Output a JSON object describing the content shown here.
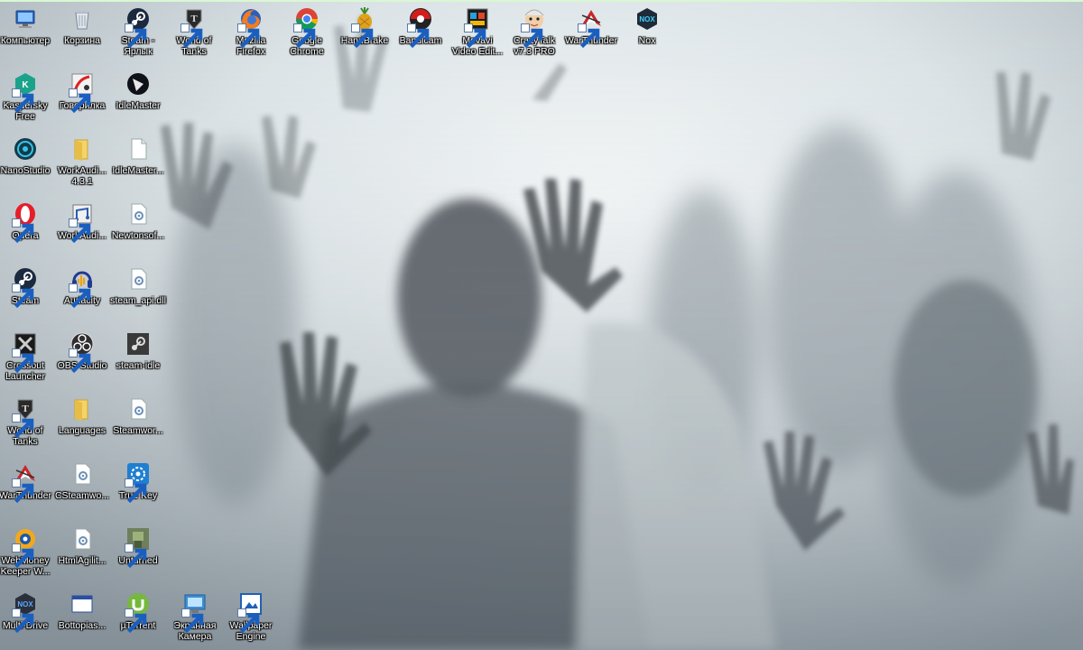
{
  "desktop": {
    "icons": [
      {
        "label": "Компьютер",
        "icon": "computer-icon"
      },
      {
        "label": "Корзина",
        "icon": "recycle-bin-icon"
      },
      {
        "label": "Steam -\nЯрлык",
        "icon": "steam-icon"
      },
      {
        "label": "World of\nTanks",
        "icon": "world-of-tanks-icon"
      },
      {
        "label": "Mozilla\nFirefox",
        "icon": "firefox-icon"
      },
      {
        "label": "Google\nChrome",
        "icon": "chrome-icon"
      },
      {
        "label": "HandBrake",
        "icon": "handbrake-icon"
      },
      {
        "label": "Bandicam",
        "icon": "bandicam-icon"
      },
      {
        "label": "Movavi\nVideo Edit...",
        "icon": "movavi-icon"
      },
      {
        "label": "CrazyTalk\nv7.3 PRO",
        "icon": "crazytalk-icon"
      },
      {
        "label": "WarThunder",
        "icon": "warthunder-icon"
      },
      {
        "label": "Nox",
        "icon": "nox-icon"
      },
      {
        "label": "Kaspersky\nFree",
        "icon": "kaspersky-icon"
      },
      {
        "label": "Говорилка",
        "icon": "govorilka-icon"
      },
      {
        "label": "IdleMaster",
        "icon": "idlemaster-icon"
      },
      {
        "label": "NanoStudio",
        "icon": "nanostudio-icon"
      },
      {
        "label": "WorkAudi...\n4.3.1",
        "icon": "folder-icon"
      },
      {
        "label": "IdleMaster...",
        "icon": "file-icon"
      },
      {
        "label": "Opera",
        "icon": "opera-icon"
      },
      {
        "label": "WorkAudi...",
        "icon": "workaudio-icon"
      },
      {
        "label": "Newtonsof...",
        "icon": "dll-icon"
      },
      {
        "label": "Steam",
        "icon": "steam-icon"
      },
      {
        "label": "Audacity",
        "icon": "audacity-icon"
      },
      {
        "label": "steam_api.dll",
        "icon": "dll-icon"
      },
      {
        "label": "Crossout\nLauncher",
        "icon": "crossout-icon"
      },
      {
        "label": "OBS Studio",
        "icon": "obs-icon"
      },
      {
        "label": "steam-idle",
        "icon": "steam-idle-icon"
      },
      {
        "label": "World of\nTanks",
        "icon": "world-of-tanks-icon"
      },
      {
        "label": "Languages",
        "icon": "folder-icon"
      },
      {
        "label": "Steamwor...",
        "icon": "dll-icon"
      },
      {
        "label": "WarThunder",
        "icon": "warthunder-icon"
      },
      {
        "label": "CSteamwo...",
        "icon": "dll-icon"
      },
      {
        "label": "True Key",
        "icon": "truekey-icon"
      },
      {
        "label": "WebMoney\nKeeper W...",
        "icon": "webmoney-icon"
      },
      {
        "label": "HtmlAgilit...",
        "icon": "dll-icon"
      },
      {
        "label": "Unturned",
        "icon": "unturned-icon"
      },
      {
        "label": "Multi-Drive",
        "icon": "multidrive-icon"
      },
      {
        "label": "Bottopias...",
        "icon": "window-icon"
      },
      {
        "label": "µTorrent",
        "icon": "utorrent-icon"
      },
      {
        "label": "Экранная\nКамера",
        "icon": "screen-camera-icon"
      },
      {
        "label": "Wallpaper\nEngine",
        "icon": "wallpaper-engine-icon"
      }
    ]
  }
}
